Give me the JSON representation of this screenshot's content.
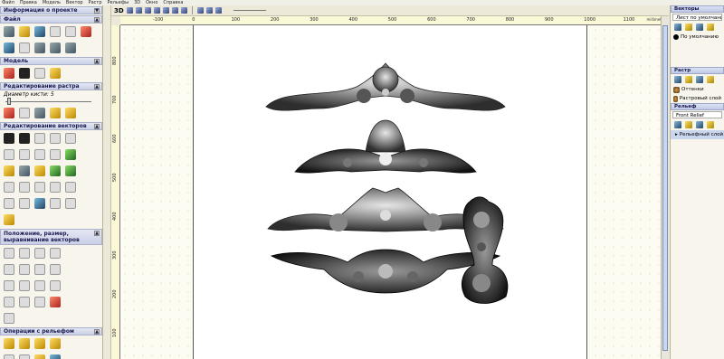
{
  "menu": [
    "Файл",
    "Правка",
    "Модель",
    "Вектор",
    "Растр",
    "Рельефы",
    "3D",
    "Окно",
    "Справка"
  ],
  "left_panel": {
    "project_info": "Информация о проекте",
    "file": "Файл",
    "model": "Модель",
    "raster_edit": "Редактирование растра",
    "brush_diameter_label": "Диаметр кисти:",
    "brush_diameter_value": "5",
    "vector_edit": "Редактирование векторов",
    "vector_position": "Положение, размер, выравнивание векторов",
    "relief_ops": "Операции с рельефом"
  },
  "toolbar": {
    "mode_label": "3D"
  },
  "rulers": {
    "top_ticks": [
      "-100",
      "0",
      "100",
      "200",
      "300",
      "400",
      "500",
      "600",
      "700",
      "800",
      "900",
      "1000",
      "1100"
    ],
    "left_ticks": [
      "800",
      "700",
      "600",
      "500",
      "400",
      "300",
      "200",
      "100"
    ],
    "unit": "millimeters"
  },
  "right_panel": {
    "vectors_title": "Векторы",
    "vectors_sheet": "Лист по умолчанию",
    "vectors_layer": "По умолчанию",
    "raster_title": "Растр",
    "raster_layer1": "Оттенки",
    "raster_layer2": "Растровый слой",
    "relief_title": "Рельеф",
    "relief_name": "Front Relief",
    "relief_layer": "Рельефный слой"
  },
  "colors": {
    "panel_header": "#c9cfe6",
    "canvas_bg": "#fdfcf2",
    "sheet": "#ffffff",
    "ruler": "#fbf8d8"
  }
}
